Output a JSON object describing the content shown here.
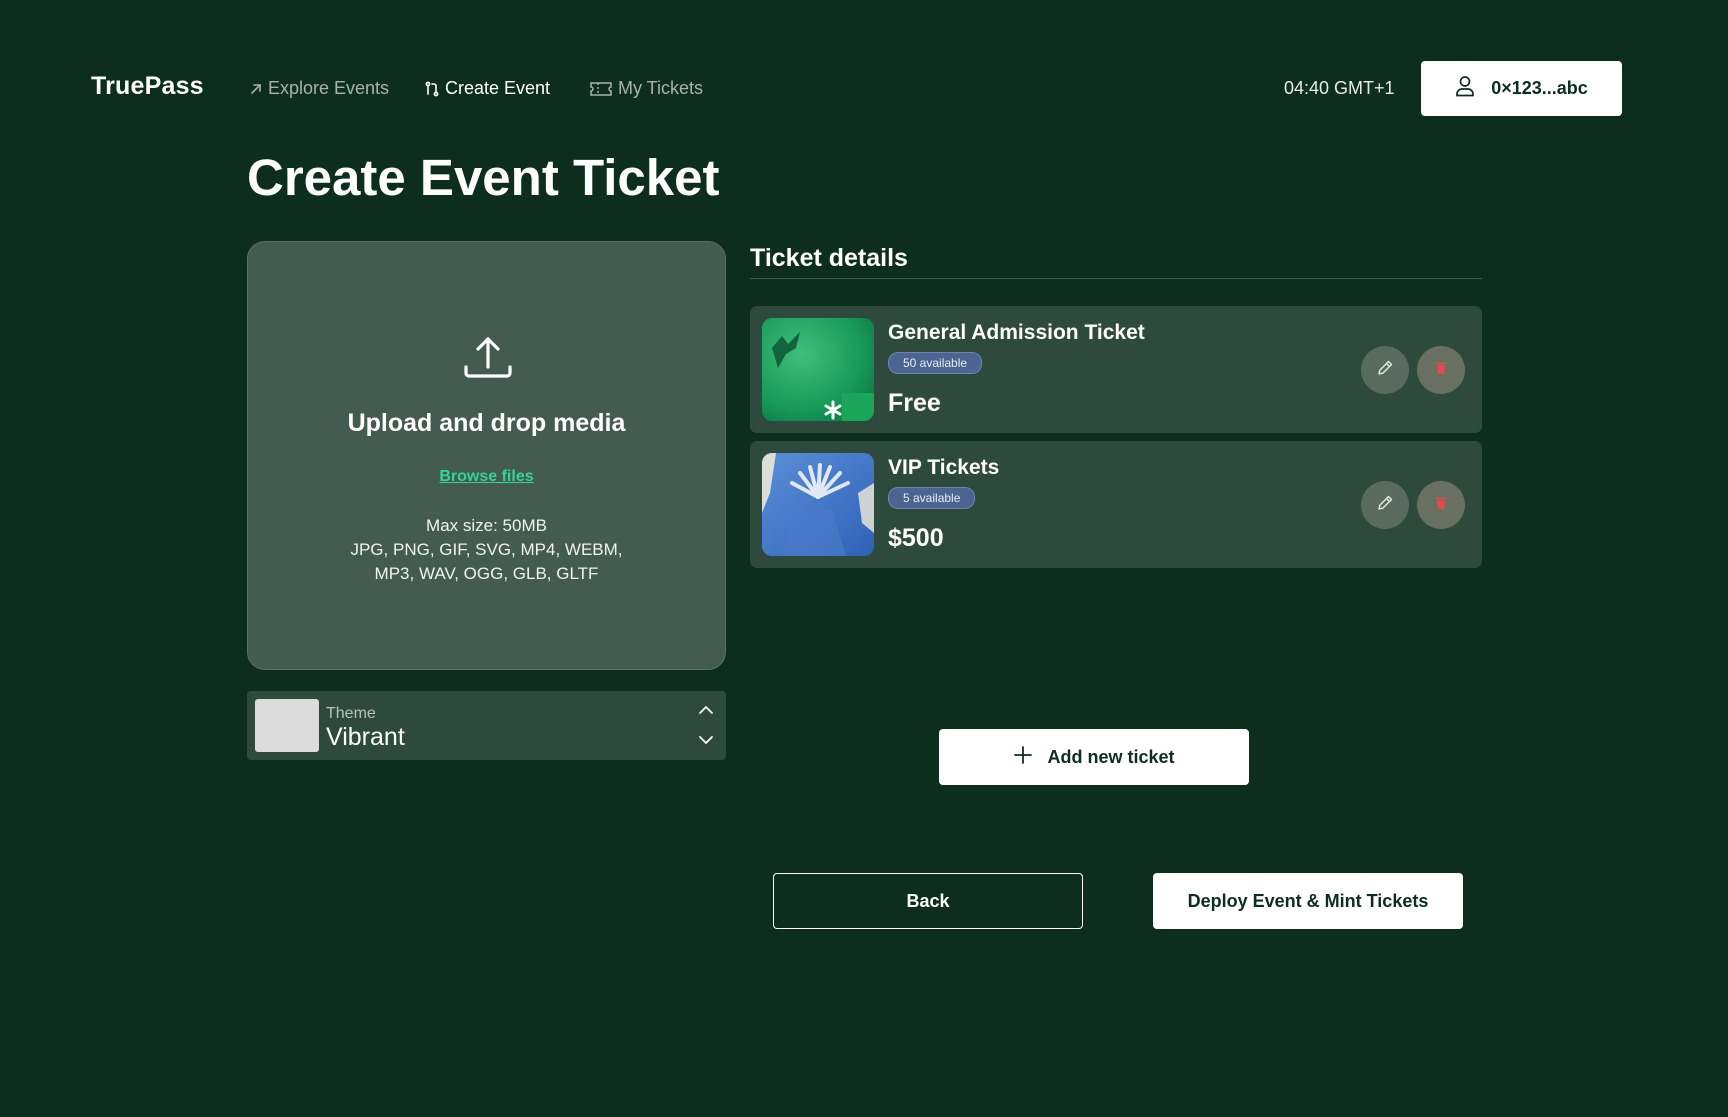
{
  "app": {
    "brand": "TruePass"
  },
  "nav": {
    "items": [
      {
        "label": "Explore Events",
        "icon": "arrow-up-right-icon",
        "active": false
      },
      {
        "label": "Create Event",
        "icon": "route-icon",
        "active": true
      },
      {
        "label": "My Tickets",
        "icon": "ticket-icon",
        "active": false
      }
    ]
  },
  "header": {
    "clock": "04:40 GMT+1",
    "wallet_label": "0×123...abc"
  },
  "page": {
    "title": "Create Event Ticket"
  },
  "upload": {
    "title": "Upload and drop media",
    "browse_label": "Browse files",
    "max_size": "Max size: 50MB",
    "formats_line1": "JPG, PNG, GIF, SVG, MP4, WEBM,",
    "formats_line2": "MP3, WAV, OGG, GLB, GLTF"
  },
  "theme": {
    "label": "Theme",
    "value": "Vibrant"
  },
  "tickets": {
    "section_title": "Ticket details",
    "items": [
      {
        "name": "General Admission Ticket",
        "availability": "50 available",
        "price": "Free"
      },
      {
        "name": "VIP Tickets",
        "availability": "5 available",
        "price": "$500"
      }
    ]
  },
  "actions": {
    "add_ticket": "Add new ticket",
    "back": "Back",
    "deploy": "Deploy Event & Mint Tickets"
  },
  "colors": {
    "background": "#0d2e1e",
    "card": "#2e4a3c",
    "upload_panel": "#435b50",
    "link_accent": "#34d399",
    "badge": "#4b6490",
    "delete_icon": "#e5484d"
  }
}
